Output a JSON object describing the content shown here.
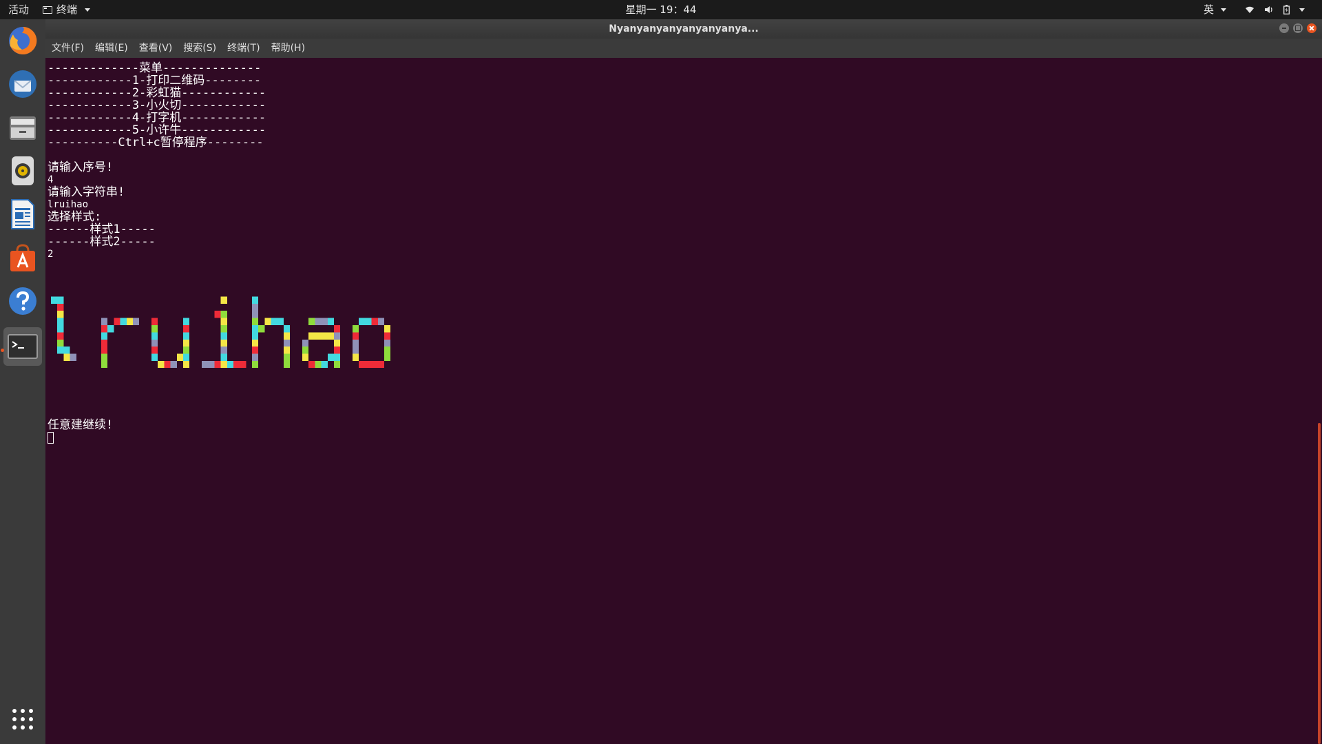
{
  "topbar": {
    "activities": "活动",
    "app_menu": "终端",
    "clock": "星期一 19：44",
    "input_method": "英"
  },
  "dock": {
    "items": [
      {
        "name": "firefox-icon"
      },
      {
        "name": "thunderbird-icon"
      },
      {
        "name": "files-icon"
      },
      {
        "name": "rhythmbox-icon"
      },
      {
        "name": "writer-icon"
      },
      {
        "name": "software-center-icon"
      },
      {
        "name": "help-icon"
      },
      {
        "name": "terminal-icon"
      }
    ]
  },
  "window": {
    "title": "Nyanyanyanyanyanyanya...",
    "menu": [
      "文件(F)",
      "编辑(E)",
      "查看(V)",
      "搜索(S)",
      "终端(T)",
      "帮助(H)"
    ]
  },
  "terminal": {
    "lines": [
      "-------------菜单--------------",
      "------------1-打印二维码--------",
      "------------2-彩虹猫------------",
      "------------3-小火切------------",
      "------------4-打字机------------",
      "------------5-小许牛------------",
      "----------Ctrl+c暂停程序--------",
      "",
      "请输入序号!",
      "4",
      "请输入字符串!",
      "lruihao",
      "选择样式:",
      "------样式1-----",
      "------样式2-----",
      "2"
    ],
    "art_text": "lruihao",
    "continue_prompt": "任意建继续!"
  },
  "colors": {
    "terminal_bg": "#300a24",
    "accent": "#e95420",
    "art_palette": [
      "#ee2b38",
      "#f4e646",
      "#42d9e0",
      "#8f92b8",
      "#8fdc3c"
    ]
  }
}
